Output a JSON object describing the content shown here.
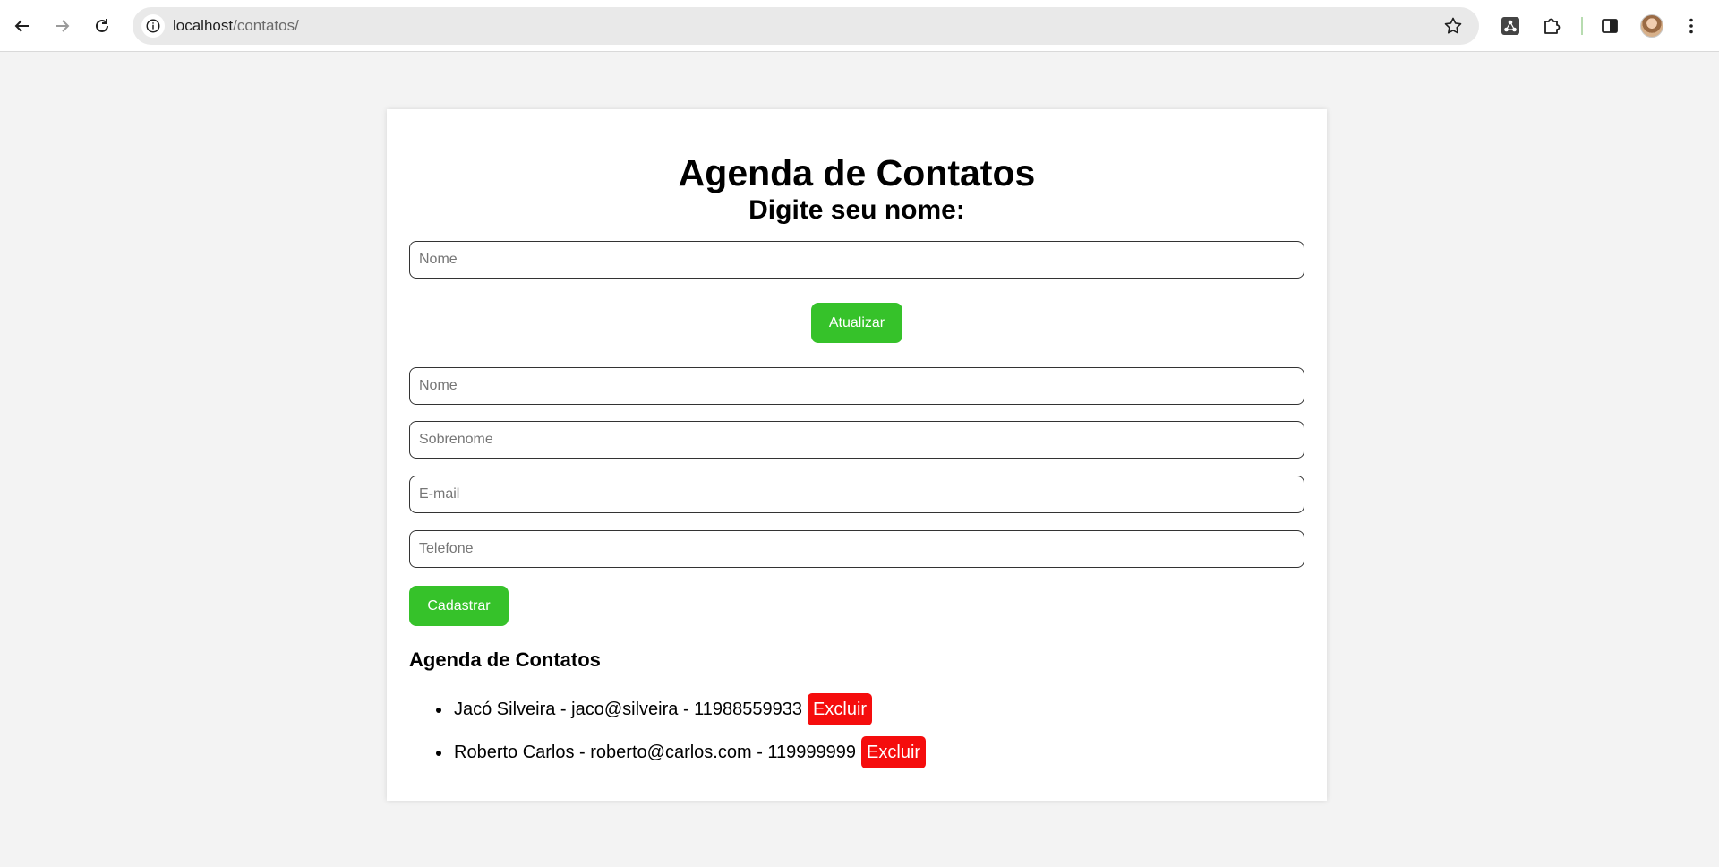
{
  "browser": {
    "url_host": "localhost",
    "url_path": "/contatos/"
  },
  "page": {
    "title": "Agenda de Contatos",
    "subtitle": "Digite seu nome:"
  },
  "update_form": {
    "name_placeholder": "Nome",
    "update_label": "Atualizar"
  },
  "register_form": {
    "name_placeholder": "Nome",
    "surname_placeholder": "Sobrenome",
    "email_placeholder": "E-mail",
    "phone_placeholder": "Telefone",
    "submit_label": "Cadastrar"
  },
  "contacts": {
    "heading": "Agenda de Contatos",
    "items": [
      {
        "text": "Jacó Silveira - jaco@silveira - 11988559933",
        "delete_label": "Excluir"
      },
      {
        "text": "Roberto Carlos - roberto@carlos.com - 119999999",
        "delete_label": "Excluir"
      }
    ]
  },
  "colors": {
    "primary_button": "#36c22a",
    "delete_button": "#f50d0d",
    "page_background": "#f3f3f3"
  }
}
